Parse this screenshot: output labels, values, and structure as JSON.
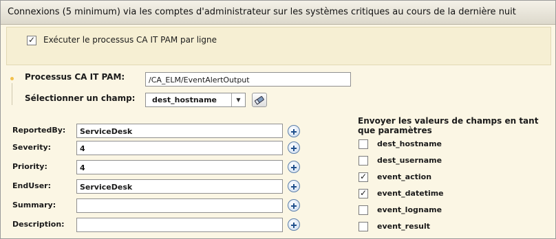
{
  "title": "Connexions (5 minimum) via les comptes d'administrateur sur les systèmes critiques au cours de la dernière nuit",
  "execute_per_line": {
    "label": "Exécuter le processus CA IT PAM par ligne",
    "checked": true
  },
  "process": {
    "label": "Processus CA IT PAM:",
    "value": "/CA_ELM/EventAlertOutput"
  },
  "field_select": {
    "label": "Sélectionner un champ:",
    "value": "dest_hostname"
  },
  "fields": [
    {
      "label": "ReportedBy:",
      "value": "ServiceDesk"
    },
    {
      "label": "Severity:",
      "value": "4"
    },
    {
      "label": "Priority:",
      "value": "4"
    },
    {
      "label": "EndUser:",
      "value": "ServiceDesk"
    },
    {
      "label": "Summary:",
      "value": ""
    },
    {
      "label": "Description:",
      "value": ""
    }
  ],
  "send_values": {
    "header": "Envoyer les valeurs de champs en tant que paramètres",
    "items": [
      {
        "label": "dest_hostname",
        "checked": false
      },
      {
        "label": "dest_username",
        "checked": false
      },
      {
        "label": "event_action",
        "checked": true
      },
      {
        "label": "event_datetime",
        "checked": true
      },
      {
        "label": "event_logname",
        "checked": false
      },
      {
        "label": "event_result",
        "checked": false
      }
    ]
  },
  "icons": {
    "field_picker": "eraser-icon",
    "add": "plus-circle-icon",
    "check": "checkmark-icon"
  },
  "colors": {
    "panel_bg": "#fbf6e4",
    "section_bg": "#f6efd3",
    "required_dot": "#f1c04c",
    "plus_icon": "#1f4f8c"
  }
}
